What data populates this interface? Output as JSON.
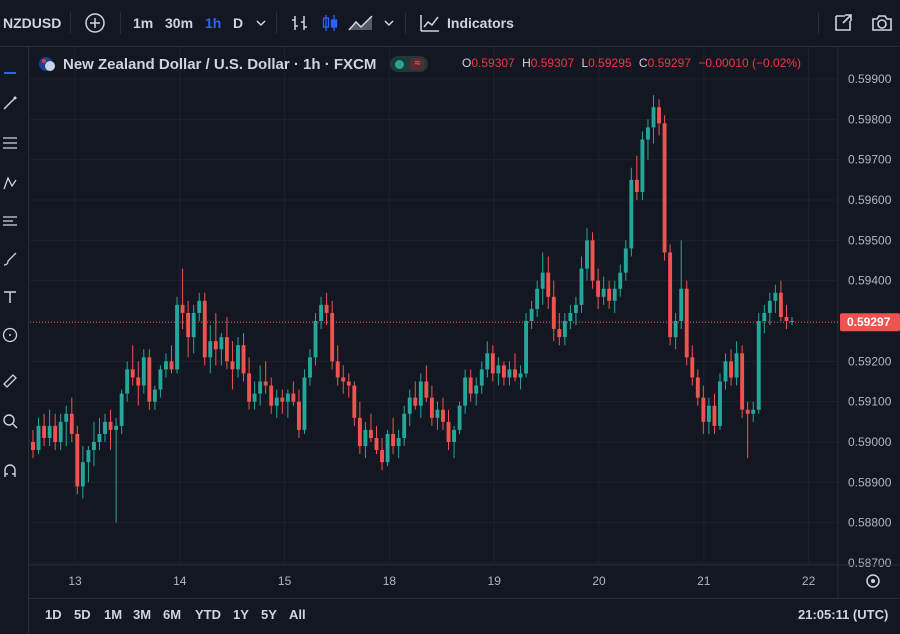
{
  "toolbar": {
    "symbol": "NZDUSD",
    "intervals": [
      "1m",
      "30m",
      "1h",
      "D"
    ],
    "active_interval": "1h",
    "indicators_label": "Indicators"
  },
  "legend": {
    "title": "New Zealand Dollar / U.S. Dollar · 1h · FXCM",
    "o_key": "O",
    "o_val": "0.59307",
    "h_key": "H",
    "h_val": "0.59307",
    "l_key": "L",
    "l_val": "0.59295",
    "c_key": "C",
    "c_val": "0.59297",
    "change": "−0.00010 (−0.02%)"
  },
  "bottom": {
    "ranges": [
      "1D",
      "5D",
      "1M",
      "3M",
      "6M",
      "YTD",
      "1Y",
      "5Y",
      "All"
    ],
    "clock": "21:05:11 (UTC)"
  },
  "colors": {
    "up": "#26a69a",
    "down": "#ef5350",
    "bg": "#131722",
    "grid": "#1e222d",
    "text": "#b2b5be"
  },
  "chart_data": {
    "type": "candlestick",
    "y_ticks": [
      "0.59900",
      "0.59800",
      "0.59700",
      "0.59600",
      "0.59500",
      "0.59400",
      "0.59300",
      "0.59200",
      "0.59100",
      "0.59000",
      "0.58900",
      "0.58800",
      "0.58700"
    ],
    "ylim": [
      0.587,
      0.5995
    ],
    "x_ticks": [
      "13",
      "14",
      "15",
      "18",
      "19",
      "20",
      "21",
      "22"
    ],
    "last_price": "0.59297",
    "last_price_value": 0.59297,
    "candles": [
      [
        0.59,
        0.5903,
        0.5896,
        0.5898
      ],
      [
        0.5898,
        0.5906,
        0.5897,
        0.5904
      ],
      [
        0.5904,
        0.5907,
        0.5899,
        0.5901
      ],
      [
        0.5901,
        0.5908,
        0.5899,
        0.5904
      ],
      [
        0.5904,
        0.5907,
        0.5898,
        0.59
      ],
      [
        0.59,
        0.5907,
        0.5898,
        0.5905
      ],
      [
        0.5905,
        0.5909,
        0.5899,
        0.5907
      ],
      [
        0.5907,
        0.5911,
        0.59,
        0.5902
      ],
      [
        0.5902,
        0.5904,
        0.5887,
        0.5889
      ],
      [
        0.5889,
        0.5899,
        0.5886,
        0.5895
      ],
      [
        0.5895,
        0.5899,
        0.589,
        0.5898
      ],
      [
        0.5898,
        0.5905,
        0.5894,
        0.59
      ],
      [
        0.59,
        0.5906,
        0.5898,
        0.5902
      ],
      [
        0.5902,
        0.5907,
        0.59,
        0.5905
      ],
      [
        0.5905,
        0.5908,
        0.5898,
        0.5903
      ],
      [
        0.5903,
        0.5906,
        0.588,
        0.5904
      ],
      [
        0.5904,
        0.5913,
        0.5902,
        0.5912
      ],
      [
        0.5912,
        0.592,
        0.591,
        0.5918
      ],
      [
        0.5918,
        0.5924,
        0.5914,
        0.5916
      ],
      [
        0.5916,
        0.592,
        0.5909,
        0.5914
      ],
      [
        0.5914,
        0.5923,
        0.5912,
        0.5921
      ],
      [
        0.5921,
        0.5923,
        0.5908,
        0.591
      ],
      [
        0.591,
        0.5914,
        0.5908,
        0.5913
      ],
      [
        0.5913,
        0.5919,
        0.5911,
        0.5918
      ],
      [
        0.5918,
        0.5922,
        0.5916,
        0.592
      ],
      [
        0.592,
        0.5924,
        0.5917,
        0.5918
      ],
      [
        0.5918,
        0.5936,
        0.5917,
        0.5934
      ],
      [
        0.5934,
        0.5943,
        0.5928,
        0.5932
      ],
      [
        0.5932,
        0.5935,
        0.5921,
        0.5926
      ],
      [
        0.5926,
        0.5934,
        0.5922,
        0.5932
      ],
      [
        0.5932,
        0.5937,
        0.593,
        0.5935
      ],
      [
        0.5935,
        0.5937,
        0.5919,
        0.5921
      ],
      [
        0.5921,
        0.5929,
        0.5917,
        0.5925
      ],
      [
        0.5925,
        0.5932,
        0.5919,
        0.5923
      ],
      [
        0.5923,
        0.5927,
        0.5919,
        0.5926
      ],
      [
        0.5926,
        0.5931,
        0.5918,
        0.592
      ],
      [
        0.592,
        0.5925,
        0.5913,
        0.5918
      ],
      [
        0.5918,
        0.5926,
        0.5916,
        0.5924
      ],
      [
        0.5924,
        0.5927,
        0.5915,
        0.5917
      ],
      [
        0.5917,
        0.5921,
        0.5908,
        0.591
      ],
      [
        0.591,
        0.5915,
        0.5908,
        0.5912
      ],
      [
        0.5912,
        0.5919,
        0.5909,
        0.5915
      ],
      [
        0.5915,
        0.592,
        0.5912,
        0.5914
      ],
      [
        0.5914,
        0.5916,
        0.5907,
        0.5909
      ],
      [
        0.5909,
        0.5913,
        0.5906,
        0.5911
      ],
      [
        0.5911,
        0.5913,
        0.5907,
        0.591
      ],
      [
        0.591,
        0.5913,
        0.5906,
        0.5912
      ],
      [
        0.5912,
        0.5915,
        0.5909,
        0.591
      ],
      [
        0.591,
        0.5913,
        0.5901,
        0.5903
      ],
      [
        0.5903,
        0.5918,
        0.5902,
        0.5916
      ],
      [
        0.5916,
        0.5923,
        0.5914,
        0.5921
      ],
      [
        0.5921,
        0.5932,
        0.5919,
        0.593
      ],
      [
        0.593,
        0.5936,
        0.5928,
        0.5934
      ],
      [
        0.5934,
        0.5937,
        0.5929,
        0.5932
      ],
      [
        0.5932,
        0.5935,
        0.5918,
        0.592
      ],
      [
        0.592,
        0.5924,
        0.5914,
        0.5916
      ],
      [
        0.5916,
        0.5919,
        0.5912,
        0.5915
      ],
      [
        0.5915,
        0.5917,
        0.5911,
        0.5914
      ],
      [
        0.5914,
        0.5915,
        0.5904,
        0.5906
      ],
      [
        0.5906,
        0.591,
        0.5897,
        0.5899
      ],
      [
        0.5899,
        0.5905,
        0.5896,
        0.5903
      ],
      [
        0.5903,
        0.5907,
        0.59,
        0.5901
      ],
      [
        0.5901,
        0.5904,
        0.5897,
        0.5898
      ],
      [
        0.5898,
        0.5901,
        0.5893,
        0.5895
      ],
      [
        0.5895,
        0.5903,
        0.5894,
        0.5902
      ],
      [
        0.5902,
        0.5906,
        0.5897,
        0.5899
      ],
      [
        0.5899,
        0.5903,
        0.5896,
        0.5901
      ],
      [
        0.5901,
        0.5909,
        0.5899,
        0.5907
      ],
      [
        0.5907,
        0.5913,
        0.5904,
        0.5911
      ],
      [
        0.5911,
        0.5915,
        0.5908,
        0.5909
      ],
      [
        0.5909,
        0.5917,
        0.5906,
        0.5915
      ],
      [
        0.5915,
        0.5919,
        0.591,
        0.5911
      ],
      [
        0.5911,
        0.5914,
        0.5904,
        0.5906
      ],
      [
        0.5906,
        0.591,
        0.5903,
        0.5908
      ],
      [
        0.5908,
        0.5911,
        0.5903,
        0.5905
      ],
      [
        0.5905,
        0.5908,
        0.5898,
        0.59
      ],
      [
        0.59,
        0.5904,
        0.5896,
        0.5903
      ],
      [
        0.5903,
        0.591,
        0.5902,
        0.5909
      ],
      [
        0.5909,
        0.5918,
        0.5907,
        0.5916
      ],
      [
        0.5916,
        0.5918,
        0.591,
        0.5912
      ],
      [
        0.5912,
        0.5916,
        0.5909,
        0.5914
      ],
      [
        0.5914,
        0.592,
        0.5912,
        0.5918
      ],
      [
        0.5918,
        0.5925,
        0.5916,
        0.5922
      ],
      [
        0.5922,
        0.5924,
        0.5915,
        0.5917
      ],
      [
        0.5917,
        0.5921,
        0.5914,
        0.5919
      ],
      [
        0.5919,
        0.592,
        0.5914,
        0.5916
      ],
      [
        0.5916,
        0.592,
        0.5914,
        0.5918
      ],
      [
        0.5918,
        0.5922,
        0.5915,
        0.5916
      ],
      [
        0.5916,
        0.5919,
        0.5913,
        0.5917
      ],
      [
        0.5917,
        0.5932,
        0.5916,
        0.593
      ],
      [
        0.593,
        0.5935,
        0.5928,
        0.5933
      ],
      [
        0.5933,
        0.594,
        0.5931,
        0.5938
      ],
      [
        0.5938,
        0.5947,
        0.5934,
        0.5942
      ],
      [
        0.5942,
        0.5946,
        0.5933,
        0.5936
      ],
      [
        0.5936,
        0.594,
        0.5925,
        0.5928
      ],
      [
        0.5928,
        0.5932,
        0.5924,
        0.5926
      ],
      [
        0.5926,
        0.5932,
        0.5924,
        0.593
      ],
      [
        0.593,
        0.5934,
        0.5928,
        0.5932
      ],
      [
        0.5932,
        0.5936,
        0.5929,
        0.5934
      ],
      [
        0.5934,
        0.5946,
        0.5932,
        0.5943
      ],
      [
        0.5943,
        0.5953,
        0.594,
        0.595
      ],
      [
        0.595,
        0.5952,
        0.5938,
        0.594
      ],
      [
        0.594,
        0.5943,
        0.5933,
        0.5936
      ],
      [
        0.5936,
        0.5941,
        0.5934,
        0.5938
      ],
      [
        0.5938,
        0.594,
        0.5933,
        0.5935
      ],
      [
        0.5935,
        0.594,
        0.5932,
        0.5938
      ],
      [
        0.5938,
        0.5944,
        0.5936,
        0.5942
      ],
      [
        0.5942,
        0.595,
        0.594,
        0.5948
      ],
      [
        0.5948,
        0.5968,
        0.5946,
        0.5965
      ],
      [
        0.5965,
        0.5971,
        0.596,
        0.5962
      ],
      [
        0.5962,
        0.5977,
        0.596,
        0.5975
      ],
      [
        0.5975,
        0.598,
        0.597,
        0.5978
      ],
      [
        0.5978,
        0.5986,
        0.5974,
        0.5983
      ],
      [
        0.5983,
        0.5985,
        0.5976,
        0.5979
      ],
      [
        0.5979,
        0.5981,
        0.5945,
        0.5947
      ],
      [
        0.5947,
        0.5949,
        0.5924,
        0.5926
      ],
      [
        0.5926,
        0.5932,
        0.5923,
        0.593
      ],
      [
        0.593,
        0.595,
        0.5928,
        0.5938
      ],
      [
        0.5938,
        0.594,
        0.5919,
        0.5921
      ],
      [
        0.5921,
        0.5924,
        0.5914,
        0.5916
      ],
      [
        0.5916,
        0.5918,
        0.5909,
        0.5911
      ],
      [
        0.5911,
        0.5914,
        0.5902,
        0.5905
      ],
      [
        0.5905,
        0.5911,
        0.5902,
        0.5909
      ],
      [
        0.5909,
        0.5912,
        0.5902,
        0.5904
      ],
      [
        0.5904,
        0.5917,
        0.5903,
        0.5915
      ],
      [
        0.5915,
        0.5922,
        0.5913,
        0.592
      ],
      [
        0.592,
        0.5923,
        0.5914,
        0.5916
      ],
      [
        0.5916,
        0.5925,
        0.5914,
        0.5922
      ],
      [
        0.5922,
        0.5924,
        0.5906,
        0.5908
      ],
      [
        0.5908,
        0.591,
        0.5896,
        0.5907
      ],
      [
        0.5907,
        0.591,
        0.5905,
        0.5908
      ],
      [
        0.5908,
        0.5932,
        0.5907,
        0.593
      ],
      [
        0.593,
        0.5934,
        0.5927,
        0.5932
      ],
      [
        0.5932,
        0.5937,
        0.5929,
        0.5935
      ],
      [
        0.5935,
        0.5939,
        0.5932,
        0.5937
      ],
      [
        0.5937,
        0.594,
        0.593,
        0.5931
      ],
      [
        0.5931,
        0.5934,
        0.5928,
        0.593
      ],
      [
        0.593,
        0.5931,
        0.5929,
        0.593
      ]
    ]
  }
}
